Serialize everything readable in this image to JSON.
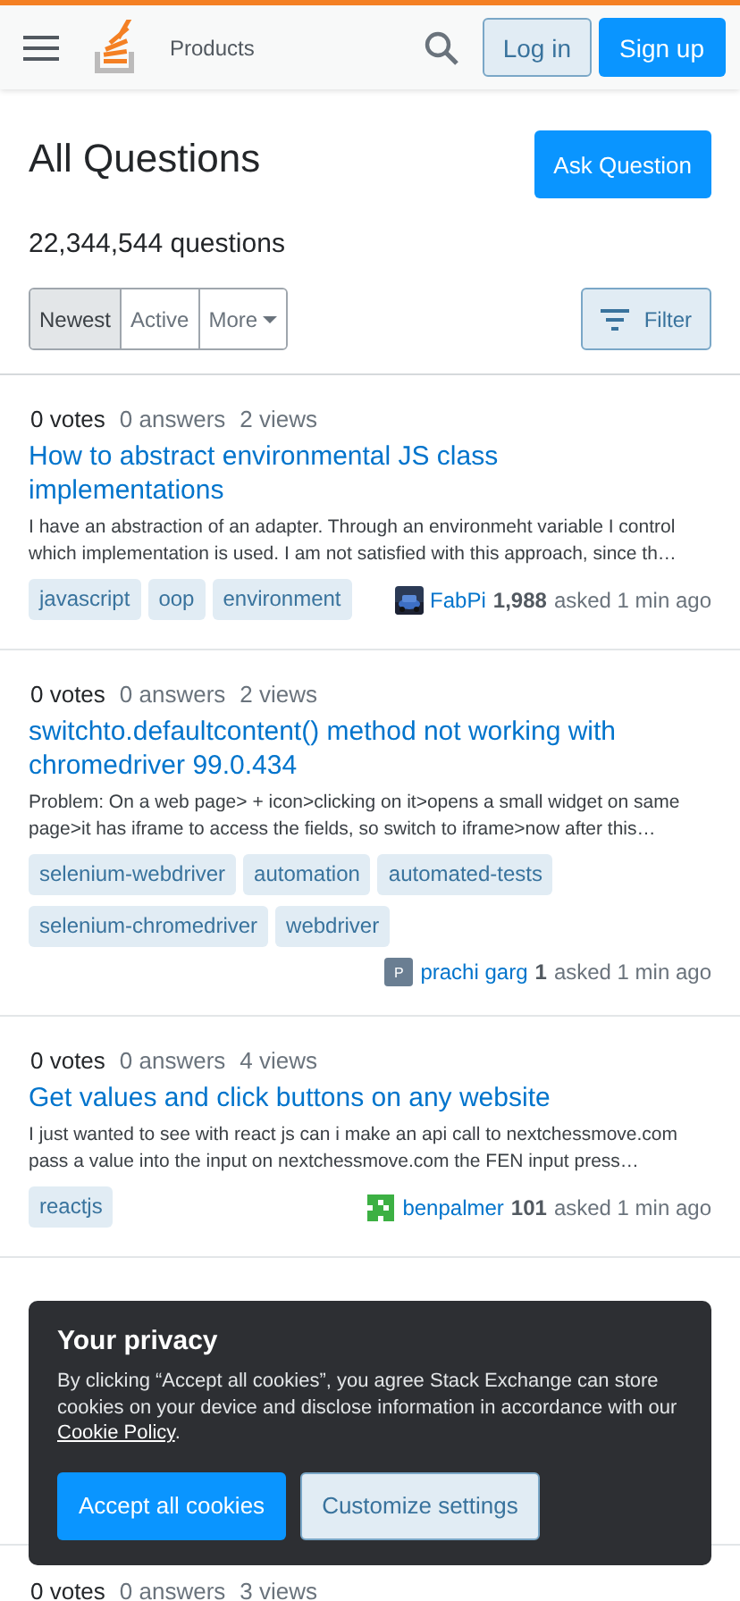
{
  "header": {
    "products": "Products",
    "login": "Log in",
    "signup": "Sign up"
  },
  "page": {
    "title": "All Questions",
    "ask": "Ask Question",
    "count": "22,344,544 questions"
  },
  "tabs": [
    {
      "label": "Newest",
      "selected": true
    },
    {
      "label": "Active",
      "selected": false
    },
    {
      "label": "More",
      "selected": false
    }
  ],
  "filter": "Filter",
  "questions": [
    {
      "votes": "0 votes",
      "answers": "0 answers",
      "views": "2 views",
      "title": "How to abstract environmental JS class implementations",
      "excerpt": "I have an abstraction of an adapter. Through an environmeht variable I control which implementation is used. I am not satisfied with this approach, since th…",
      "tags": [
        "javascript",
        "oop",
        "environment"
      ],
      "user": "FabPi",
      "rep": "1,988",
      "asked": "asked 1 min ago"
    },
    {
      "votes": "0 votes",
      "answers": "0 answers",
      "views": "2 views",
      "title": "switchto.defaultcontent() method not working with chromedriver 99.0.434",
      "excerpt": "Problem: On a web page> + icon>clicking on it>opens a small widget on same page>it has iframe to access the fields, so switch to iframe>now after this…",
      "tags": [
        "selenium-webdriver",
        "automation",
        "automated-tests",
        "selenium-chromedriver",
        "webdriver"
      ],
      "avatar": {
        "kind": "letter",
        "letter": "P"
      },
      "user": "prachi garg",
      "rep": "1",
      "asked": "asked 1 min ago"
    },
    {
      "votes": "0 votes",
      "answers": "0 answers",
      "views": "4 views",
      "title": "Get values and click buttons on any website",
      "excerpt": "I just wanted to see with react js can i make an api call to nextchessmove.com pass a value into the input on nextchessmove.com the FEN input press…",
      "tags": [
        "reactjs"
      ],
      "avatar": {
        "kind": "identicon"
      },
      "user": "benpalmer",
      "rep": "101",
      "asked": "asked 1 min ago"
    }
  ],
  "last_question": {
    "votes": "0 votes",
    "answers": "0 answers",
    "views": "3 views"
  },
  "privacy": {
    "title": "Your privacy",
    "text": "By clicking “Accept all cookies”, you agree Stack Exchange can store cookies on your device and disclose information in accordance with our",
    "link": "Cookie Policy",
    "end": ".",
    "accept": "Accept all cookies",
    "customize": "Customize settings"
  }
}
